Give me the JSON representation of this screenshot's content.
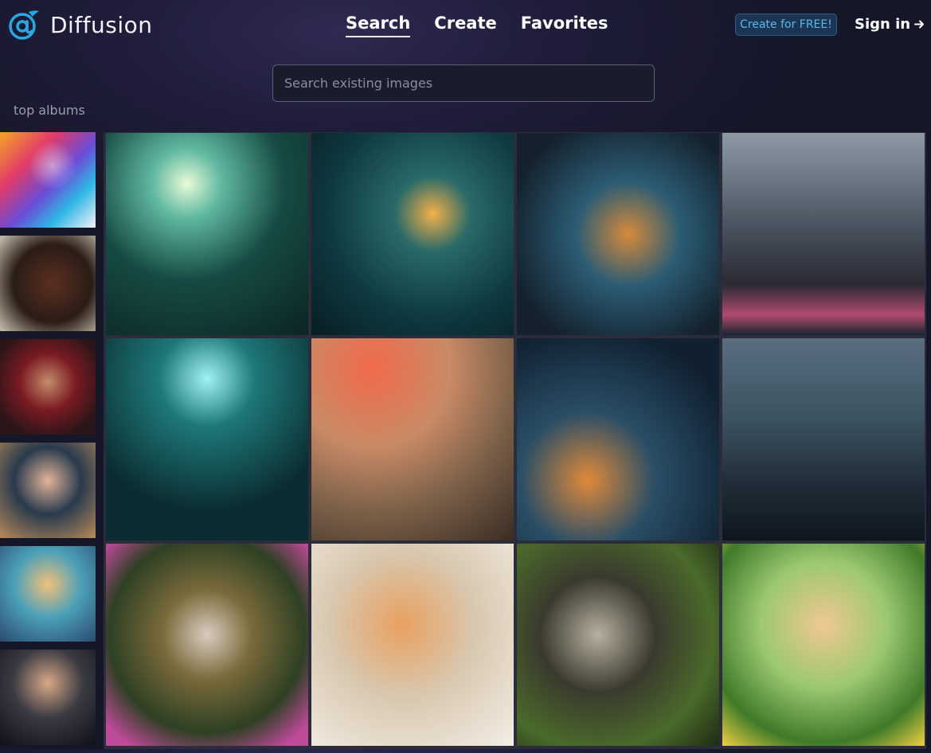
{
  "brand": {
    "name": "Diffusion",
    "logo_icon": "at-sign-wave-logo",
    "accent": "#2aa7e0"
  },
  "nav": {
    "items": [
      {
        "label": "Search",
        "active": true
      },
      {
        "label": "Create",
        "active": false
      },
      {
        "label": "Favorites",
        "active": false
      }
    ]
  },
  "header": {
    "cta_label": "Create for FREE!",
    "sign_in_label": "Sign in",
    "sign_in_icon": "arrow-right-icon"
  },
  "search": {
    "placeholder": "Search existing images",
    "value": ""
  },
  "albums": {
    "title": "top albums"
  },
  "colors": {
    "background": "#181a2e",
    "cta_text": "#59b8ef",
    "cta_border": "#2c5f87"
  }
}
